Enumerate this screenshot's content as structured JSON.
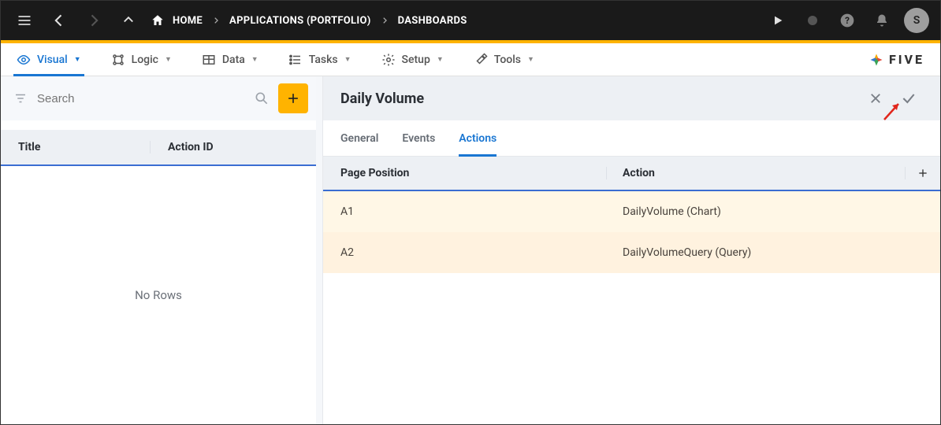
{
  "topbar": {
    "breadcrumbs": [
      "HOME",
      "APPLICATIONS (PORTFOLIO)",
      "DASHBOARDS"
    ],
    "avatar_initial": "S"
  },
  "nav": {
    "items": [
      {
        "label": "Visual"
      },
      {
        "label": "Logic"
      },
      {
        "label": "Data"
      },
      {
        "label": "Tasks"
      },
      {
        "label": "Setup"
      },
      {
        "label": "Tools"
      }
    ],
    "brand": "FIVE"
  },
  "left": {
    "search_placeholder": "Search",
    "columns": {
      "title": "Title",
      "action_id": "Action ID"
    },
    "empty_text": "No Rows"
  },
  "form": {
    "title": "Daily Volume",
    "tabs": [
      "General",
      "Events",
      "Actions"
    ],
    "active_tab": "Actions",
    "grid_columns": {
      "page_position": "Page Position",
      "action": "Action"
    },
    "rows": [
      {
        "position": "A1",
        "action": "DailyVolume (Chart)"
      },
      {
        "position": "A2",
        "action": "DailyVolumeQuery (Query)"
      }
    ]
  }
}
